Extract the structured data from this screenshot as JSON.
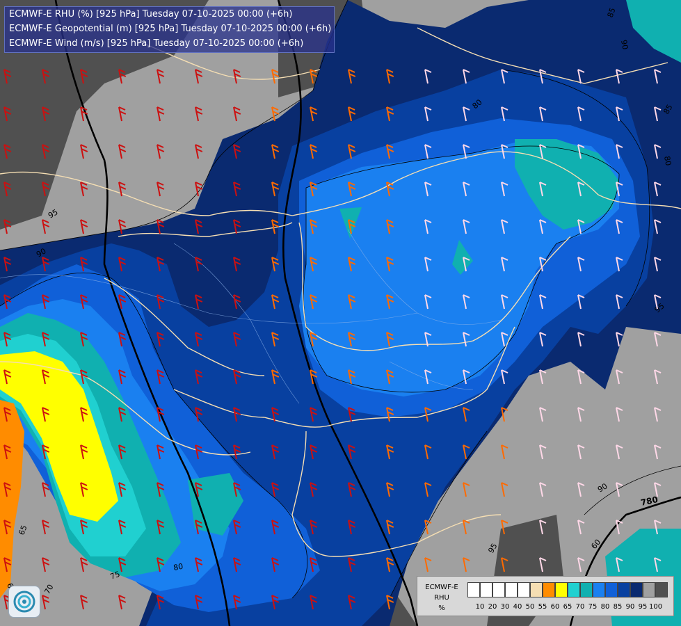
{
  "header": {
    "line1": "ECMWF-E RHU (%) [925 hPa] Tuesday 07-10-2025 00:00 (+6h)",
    "line2": "ECMWF-E Geopotential (m) [925 hPa] Tuesday 07-10-2025 00:00 (+6h)",
    "line3": "ECMWF-E Wind (m/s) [925 hPa] Tuesday 07-10-2025 00:00 (+6h)"
  },
  "legend": {
    "title_line1": "ECMWF-E",
    "title_line2": "RHU",
    "title_line3": "%",
    "labels": [
      "10",
      "20",
      "30",
      "40",
      "50",
      "55",
      "60",
      "65",
      "70",
      "75",
      "80",
      "85",
      "90",
      "95",
      "100"
    ],
    "colors": [
      "#ffffff",
      "#ffffff",
      "#ffffff",
      "#ffffff",
      "#ffffff",
      "#f5deb3",
      "#ff8c00",
      "#ffff00",
      "#20d0d0",
      "#10b0b0",
      "#1a80f0",
      "#1060d8",
      "#0840a0",
      "#0a2a70",
      "#a0a0a0",
      "#505050"
    ]
  },
  "contour_labels": {
    "c95_top": "95",
    "c80_top": "80",
    "c85_top": "85",
    "c90_top": "90",
    "c80_mid": "80",
    "c85_right": "85",
    "c90_left": "90",
    "c95_left": "95",
    "c65_left": "65",
    "c60_left": "60",
    "c70_left": "70",
    "c75_bottom": "75",
    "c80_bottom": "80",
    "c90_right": "90",
    "c780": "780",
    "c95_bottom": "95",
    "c60_right": "60"
  },
  "colors": {
    "gray_dark": "#505050",
    "gray_light": "#a0a0a0",
    "navy": "#0a2a70",
    "blue_dark": "#0840a0",
    "blue_mid": "#1060d8",
    "blue_light": "#1a80f0",
    "teal": "#10b0b0",
    "cyan": "#20d0d0",
    "yellow": "#ffff00",
    "orange": "#ff8c00"
  }
}
